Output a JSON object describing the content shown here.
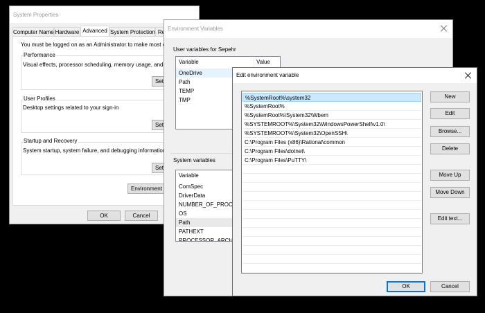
{
  "system_properties": {
    "title": "System Properties",
    "tabs": [
      {
        "label": "Computer Name"
      },
      {
        "label": "Hardware"
      },
      {
        "label": "Advanced"
      },
      {
        "label": "System Protection"
      },
      {
        "label": "Re"
      }
    ],
    "admin_note": "You must be logged on as an Administrator to make most of these",
    "performance": {
      "title": "Performance",
      "desc": "Visual effects, processor scheduling, memory usage, and virtual",
      "button": "Sett"
    },
    "user_profiles": {
      "title": "User Profiles",
      "desc": "Desktop settings related to your sign-in",
      "button": "Sett"
    },
    "startup": {
      "title": "Startup and Recovery",
      "desc": "System startup, system failure, and debugging information",
      "button": "Sett"
    },
    "env_button": "Environment V",
    "ok": "OK",
    "cancel": "Cancel"
  },
  "env_vars": {
    "title": "Environment Variables",
    "user_label": "User variables for Sepehr",
    "user_headers": {
      "variable": "Variable",
      "value": "Value"
    },
    "user_rows": [
      "OneDrive",
      "Path",
      "TEMP",
      "TMP"
    ],
    "system_label": "System variables",
    "system_header": "Variable",
    "system_rows": [
      "ComSpec",
      "DriverData",
      "NUMBER_OF_PROCES",
      "OS",
      "Path",
      "PATHEXT",
      "PROCESSOR_ARCHITE"
    ]
  },
  "edit_env": {
    "title": "Edit environment variable",
    "paths": [
      "%SystemRoot%\\system32",
      "%SystemRoot%",
      "%SystemRoot%\\System32\\Wbem",
      "%SYSTEMROOT%\\System32\\WindowsPowerShell\\v1.0\\",
      "%SYSTEMROOT%\\System32\\OpenSSH\\",
      "C:\\Program Files (x86)\\Rational\\common",
      "C:\\Program Files\\dotnet\\",
      "C:\\Program Files\\PuTTY\\"
    ],
    "buttons": {
      "new": "New",
      "edit": "Edit",
      "browse": "Browse...",
      "delete": "Delete",
      "move_up": "Move Up",
      "move_down": "Move Down",
      "edit_text": "Edit text...",
      "ok": "OK",
      "cancel": "Cancel"
    }
  },
  "colors": {
    "selection": "#cce8ff",
    "selection_border": "#99d1ff",
    "default_button": "#0078d7"
  }
}
